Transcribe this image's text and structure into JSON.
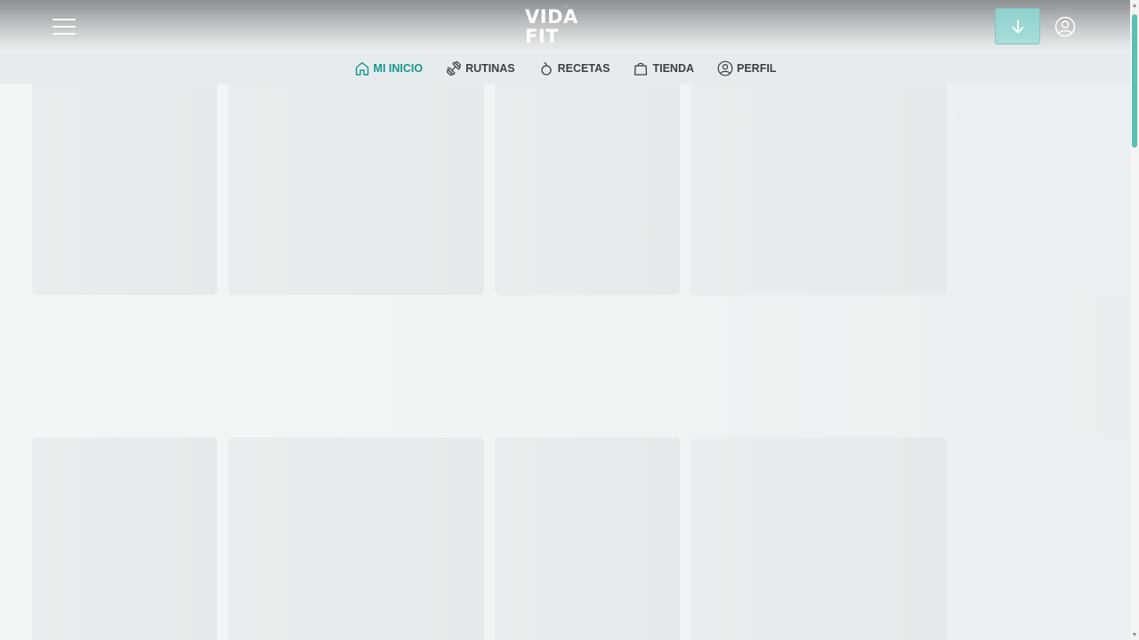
{
  "brand": {
    "name": "VIDA FIT",
    "accent_color": "#17968a"
  },
  "header": {
    "menu_icon": "hamburger-menu-icon",
    "download_icon": "arrow-down-icon",
    "account_icon": "user-circle-icon"
  },
  "nav": {
    "items": [
      {
        "label": "MI INICIO",
        "icon": "home-icon",
        "active": true
      },
      {
        "label": "RUTINAS",
        "icon": "dumbbell-icon",
        "active": false
      },
      {
        "label": "RECETAS",
        "icon": "fruit-icon",
        "active": false
      },
      {
        "label": "TIENDA",
        "icon": "shopping-bag-icon",
        "active": false
      },
      {
        "label": "PERFIL",
        "icon": "user-circle-icon",
        "active": false
      }
    ]
  }
}
